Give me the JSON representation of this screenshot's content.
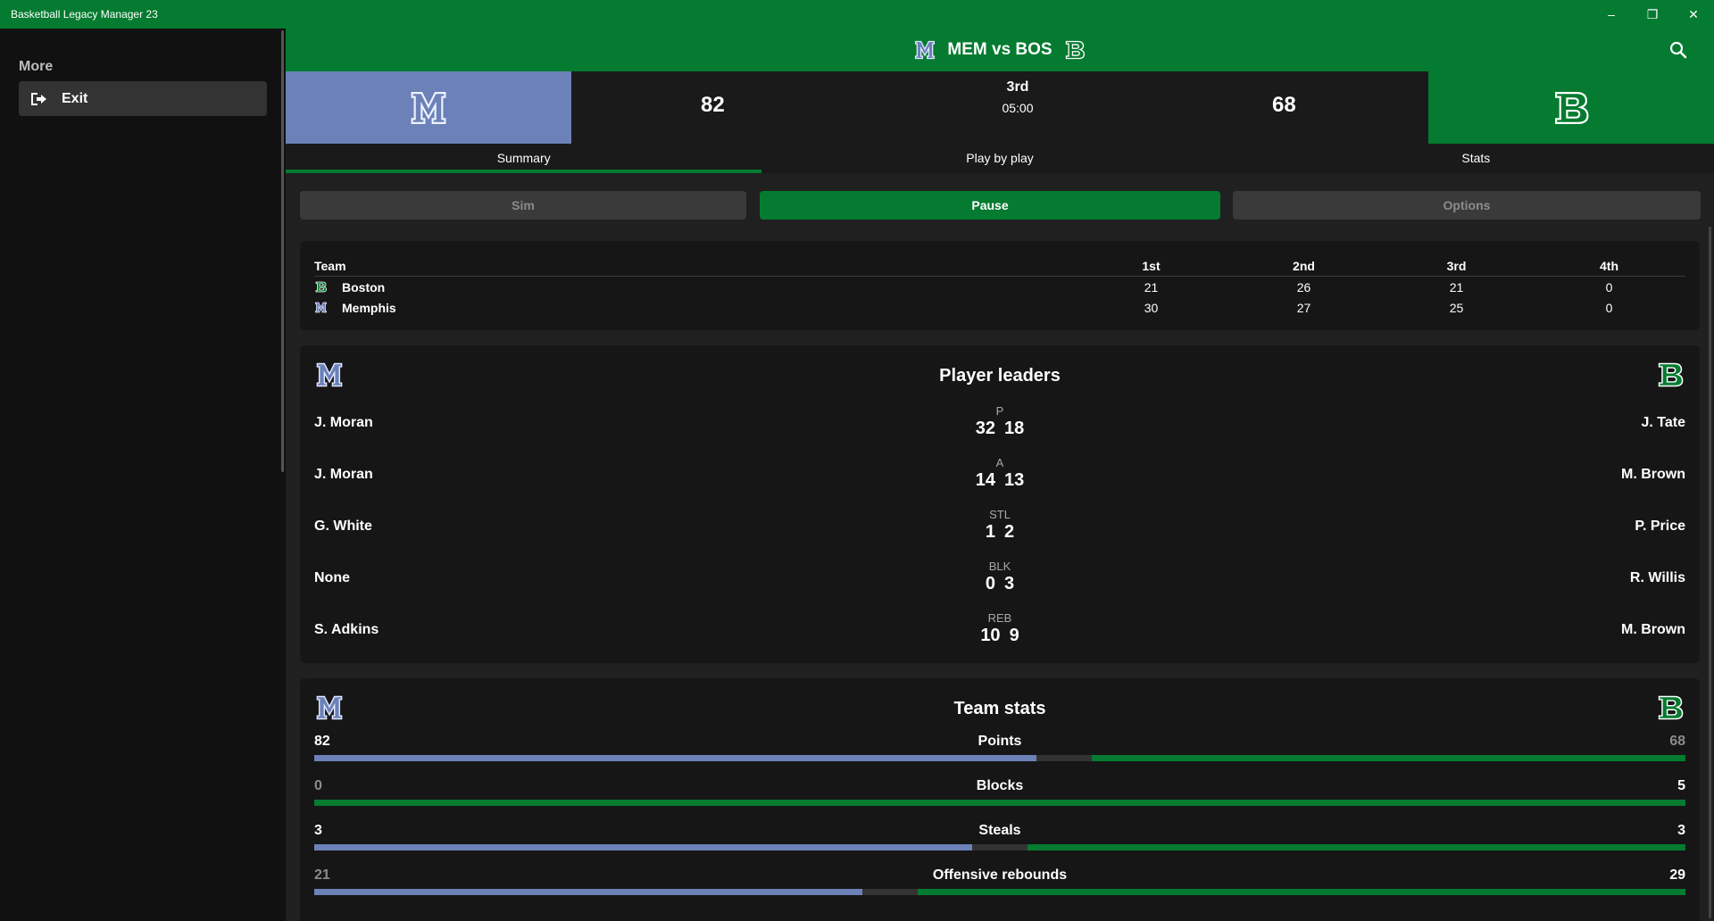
{
  "window": {
    "title": "Basketball Legacy Manager 23"
  },
  "sidebar": {
    "section_label": "More",
    "exit_label": "Exit"
  },
  "header": {
    "matchup": "MEM vs BOS"
  },
  "scoreboard": {
    "home_score": "82",
    "away_score": "68",
    "period": "3rd",
    "clock": "05:00"
  },
  "tabs": [
    {
      "label": "Summary"
    },
    {
      "label": "Play by play"
    },
    {
      "label": "Stats"
    }
  ],
  "controls": {
    "sim": "Sim",
    "pause": "Pause",
    "options": "Options"
  },
  "box_score": {
    "headers": [
      "Team",
      "1st",
      "2nd",
      "3rd",
      "4th"
    ],
    "rows": [
      {
        "team": "Boston",
        "q": [
          "21",
          "26",
          "21",
          "0"
        ]
      },
      {
        "team": "Memphis",
        "q": [
          "30",
          "27",
          "25",
          "0"
        ]
      }
    ]
  },
  "leaders": {
    "title": "Player leaders",
    "rows": [
      {
        "stat": "P",
        "left_name": "J. Moran",
        "left_val": "32",
        "right_val": "18",
        "right_name": "J. Tate"
      },
      {
        "stat": "A",
        "left_name": "J. Moran",
        "left_val": "14",
        "right_val": "13",
        "right_name": "M. Brown"
      },
      {
        "stat": "STL",
        "left_name": "G. White",
        "left_val": "1",
        "right_val": "2",
        "right_name": "P. Price"
      },
      {
        "stat": "BLK",
        "left_name": "None",
        "left_val": "0",
        "right_val": "3",
        "right_name": "R. Willis"
      },
      {
        "stat": "REB",
        "left_name": "S. Adkins",
        "left_val": "10",
        "right_val": "9",
        "right_name": "M. Brown"
      }
    ]
  },
  "team_stats": {
    "title": "Team stats",
    "rows": [
      {
        "label": "Points",
        "left": "82",
        "right": "68",
        "left_frac": 0.547
      },
      {
        "label": "Blocks",
        "left": "0",
        "right": "5",
        "left_frac": 0.0
      },
      {
        "label": "Steals",
        "left": "3",
        "right": "3",
        "left_frac": 0.5
      },
      {
        "label": "Offensive rebounds",
        "left": "21",
        "right": "29",
        "left_frac": 0.42
      }
    ]
  },
  "colors": {
    "accent": "#047b30",
    "memphis": "#6b81b8",
    "boston": "#047b30"
  }
}
